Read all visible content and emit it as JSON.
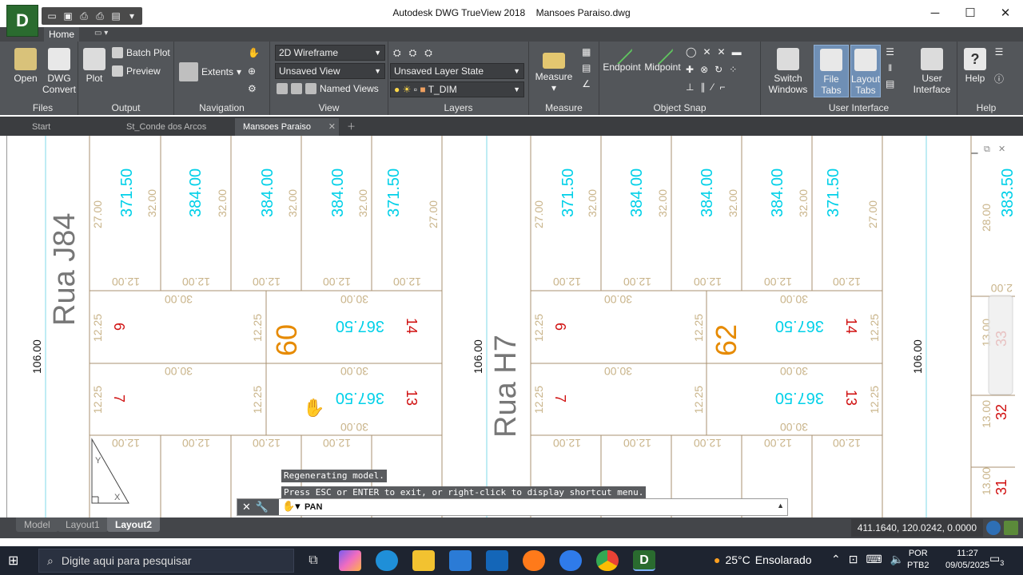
{
  "window": {
    "app_title": "Autodesk DWG TrueView 2018",
    "doc_title": "Mansoes Paraiso.dwg",
    "app_button": "D",
    "controls": {
      "minimize": "─",
      "maximize": "☐",
      "close": "✕"
    }
  },
  "ribbon": {
    "tab": "Home",
    "panels": {
      "files": {
        "title": "Files",
        "open": "Open",
        "convert_line1": "DWG",
        "convert_line2": "Convert"
      },
      "output": {
        "title": "Output",
        "plot": "Plot",
        "batch_plot": "Batch Plot",
        "preview": "Preview"
      },
      "navigation": {
        "title": "Navigation",
        "extents": "Extents"
      },
      "view": {
        "title": "View",
        "visual_style": "2D Wireframe",
        "saved_view": "Unsaved View",
        "named_views": "Named Views"
      },
      "layers": {
        "title": "Layers",
        "layer_state": "Unsaved Layer State",
        "current_layer": "T_DIM"
      },
      "measure": {
        "title": "Measure",
        "measure": "Measure"
      },
      "object_snap": {
        "title": "Object Snap",
        "endpoint": "Endpoint",
        "midpoint": "Midpoint"
      },
      "user_interface": {
        "title": "User Interface",
        "switch_line1": "Switch",
        "switch_line2": "Windows",
        "file_tabs": "File Tabs",
        "layout_line1": "Layout",
        "layout_line2": "Tabs",
        "ui_line1": "User",
        "ui_line2": "Interface"
      },
      "help": {
        "title": "Help",
        "help": "Help"
      }
    }
  },
  "doc_tabs": [
    {
      "label": "Start"
    },
    {
      "label": "St_Conde dos Arcos"
    },
    {
      "label": "Mansoes Paraiso"
    }
  ],
  "drawing": {
    "street_left": "Rua J84",
    "street_mid": "Rua H7",
    "dim_street": "106.00",
    "block_left": "60",
    "block_right": "62",
    "lot_area_a": "371.50",
    "lot_area_b": "384.00",
    "lot_area_c": "367.50",
    "dim_12": "12.00",
    "dim_30": "30.00",
    "dim_32": "32.00",
    "dim_27": "27.00",
    "dim_1225": "12.25",
    "dim_28": "28.00",
    "dim_13": "13.00",
    "dim_2": "2.00",
    "lot_6": "6",
    "lot_7": "7",
    "lot_13": "13",
    "lot_14": "14",
    "lot_31": "31",
    "lot_32": "32",
    "lot_33": "33",
    "partial_area": "383.50"
  },
  "command_line": {
    "messages": [
      "Regenerating model.",
      "Press ESC or ENTER to exit, or right-click to display shortcut menu."
    ],
    "current": "PAN"
  },
  "layout_tabs": [
    {
      "label": "Model"
    },
    {
      "label": "Layout1"
    },
    {
      "label": "Layout2"
    }
  ],
  "status": {
    "coordinates": "411.1640, 120.0242, 0.0000"
  },
  "taskbar": {
    "search_placeholder": "Digite aqui para pesquisar",
    "temperature": "25°C",
    "weather": "Ensolarado",
    "lang_line1": "POR",
    "lang_line2": "PTB2",
    "time": "11:27",
    "date": "09/05/2025",
    "notification_count": "3"
  },
  "colors": {
    "ribbon_bg": "#53565a",
    "cyan_text": "#00d0e8",
    "red_text": "#d01010",
    "orange_text": "#e68a00",
    "tan_text": "#c9b48a"
  }
}
